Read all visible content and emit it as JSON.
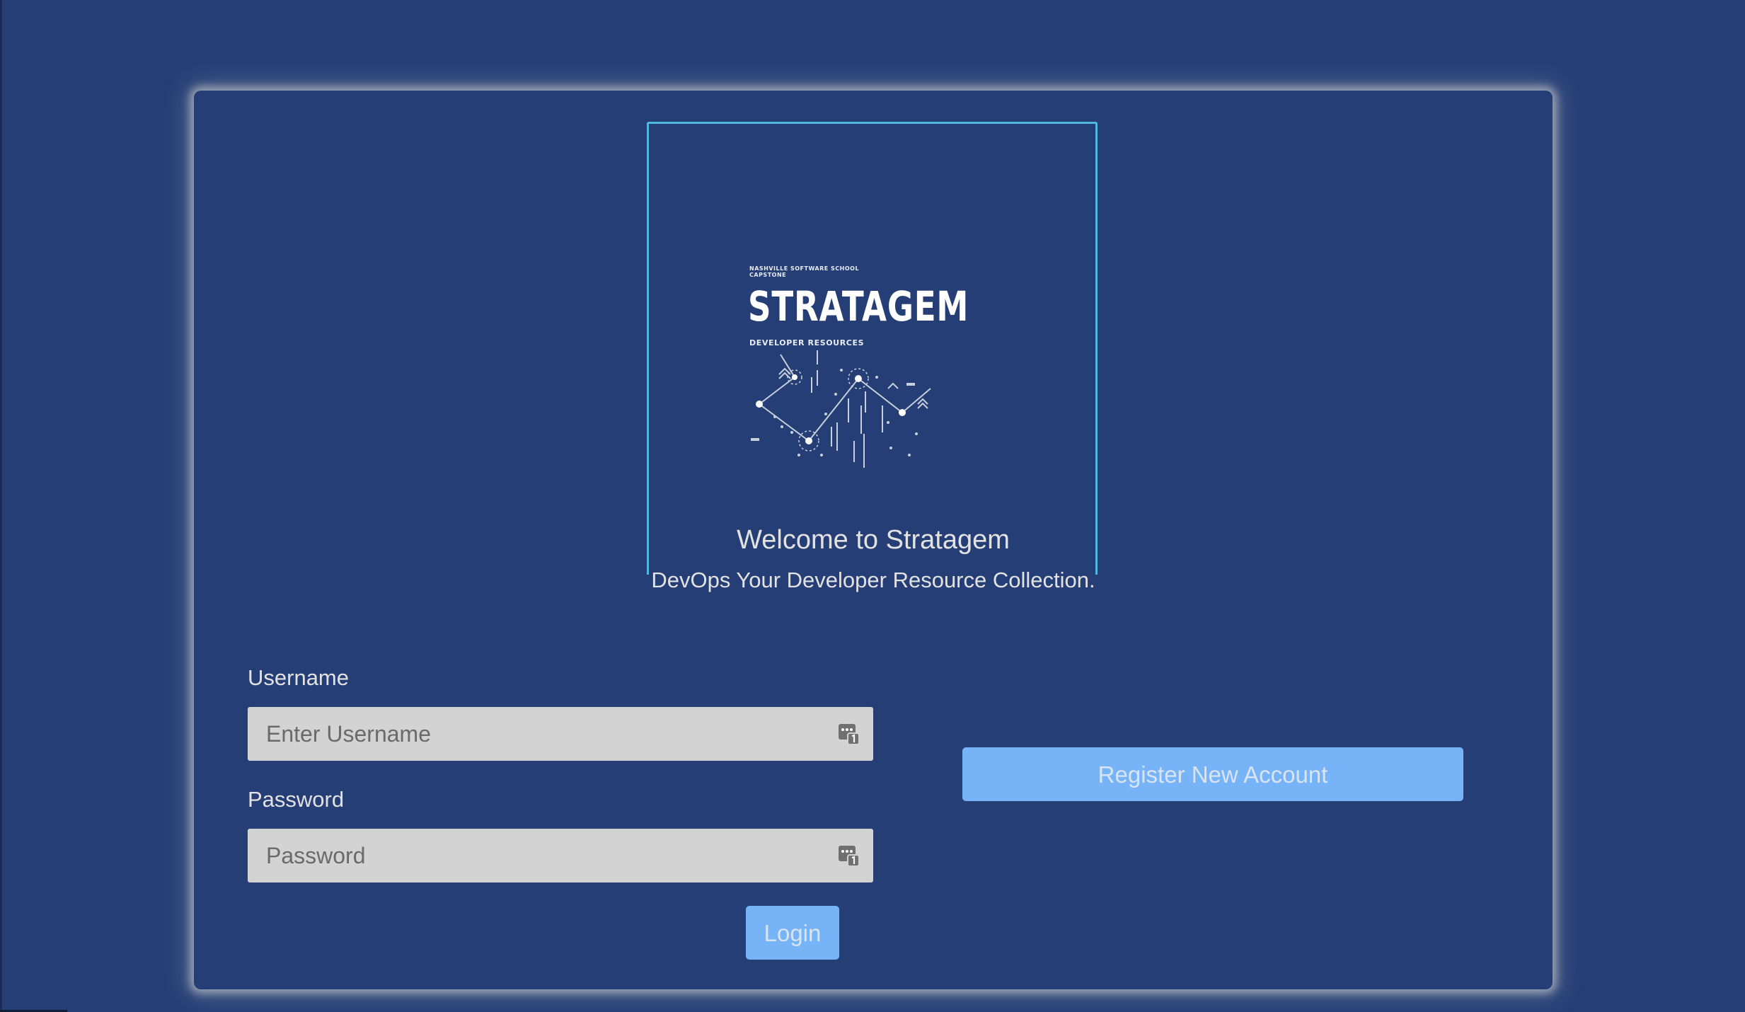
{
  "colors": {
    "background": "#253e76",
    "frame_accent": "#4fb8e2",
    "button": "#77b3f7",
    "input": "#d3d3d3"
  },
  "logo": {
    "small_text": "NASHVILLE SOFTWARE SCHOOL\nCAPSTONE",
    "title": "STRATAGEM",
    "subtitle": "DEVELOPER RESOURCES"
  },
  "welcome": {
    "title": "Welcome to Stratagem",
    "subtitle": "DevOps Your Developer Resource Collection."
  },
  "login_form": {
    "username_label": "Username",
    "username_placeholder": "Enter Username",
    "username_value": "",
    "password_label": "Password",
    "password_placeholder": "Password",
    "password_value": "",
    "field_icon": "password-manager-icon",
    "login_label": "Login"
  },
  "register": {
    "label": "Register New Account"
  }
}
